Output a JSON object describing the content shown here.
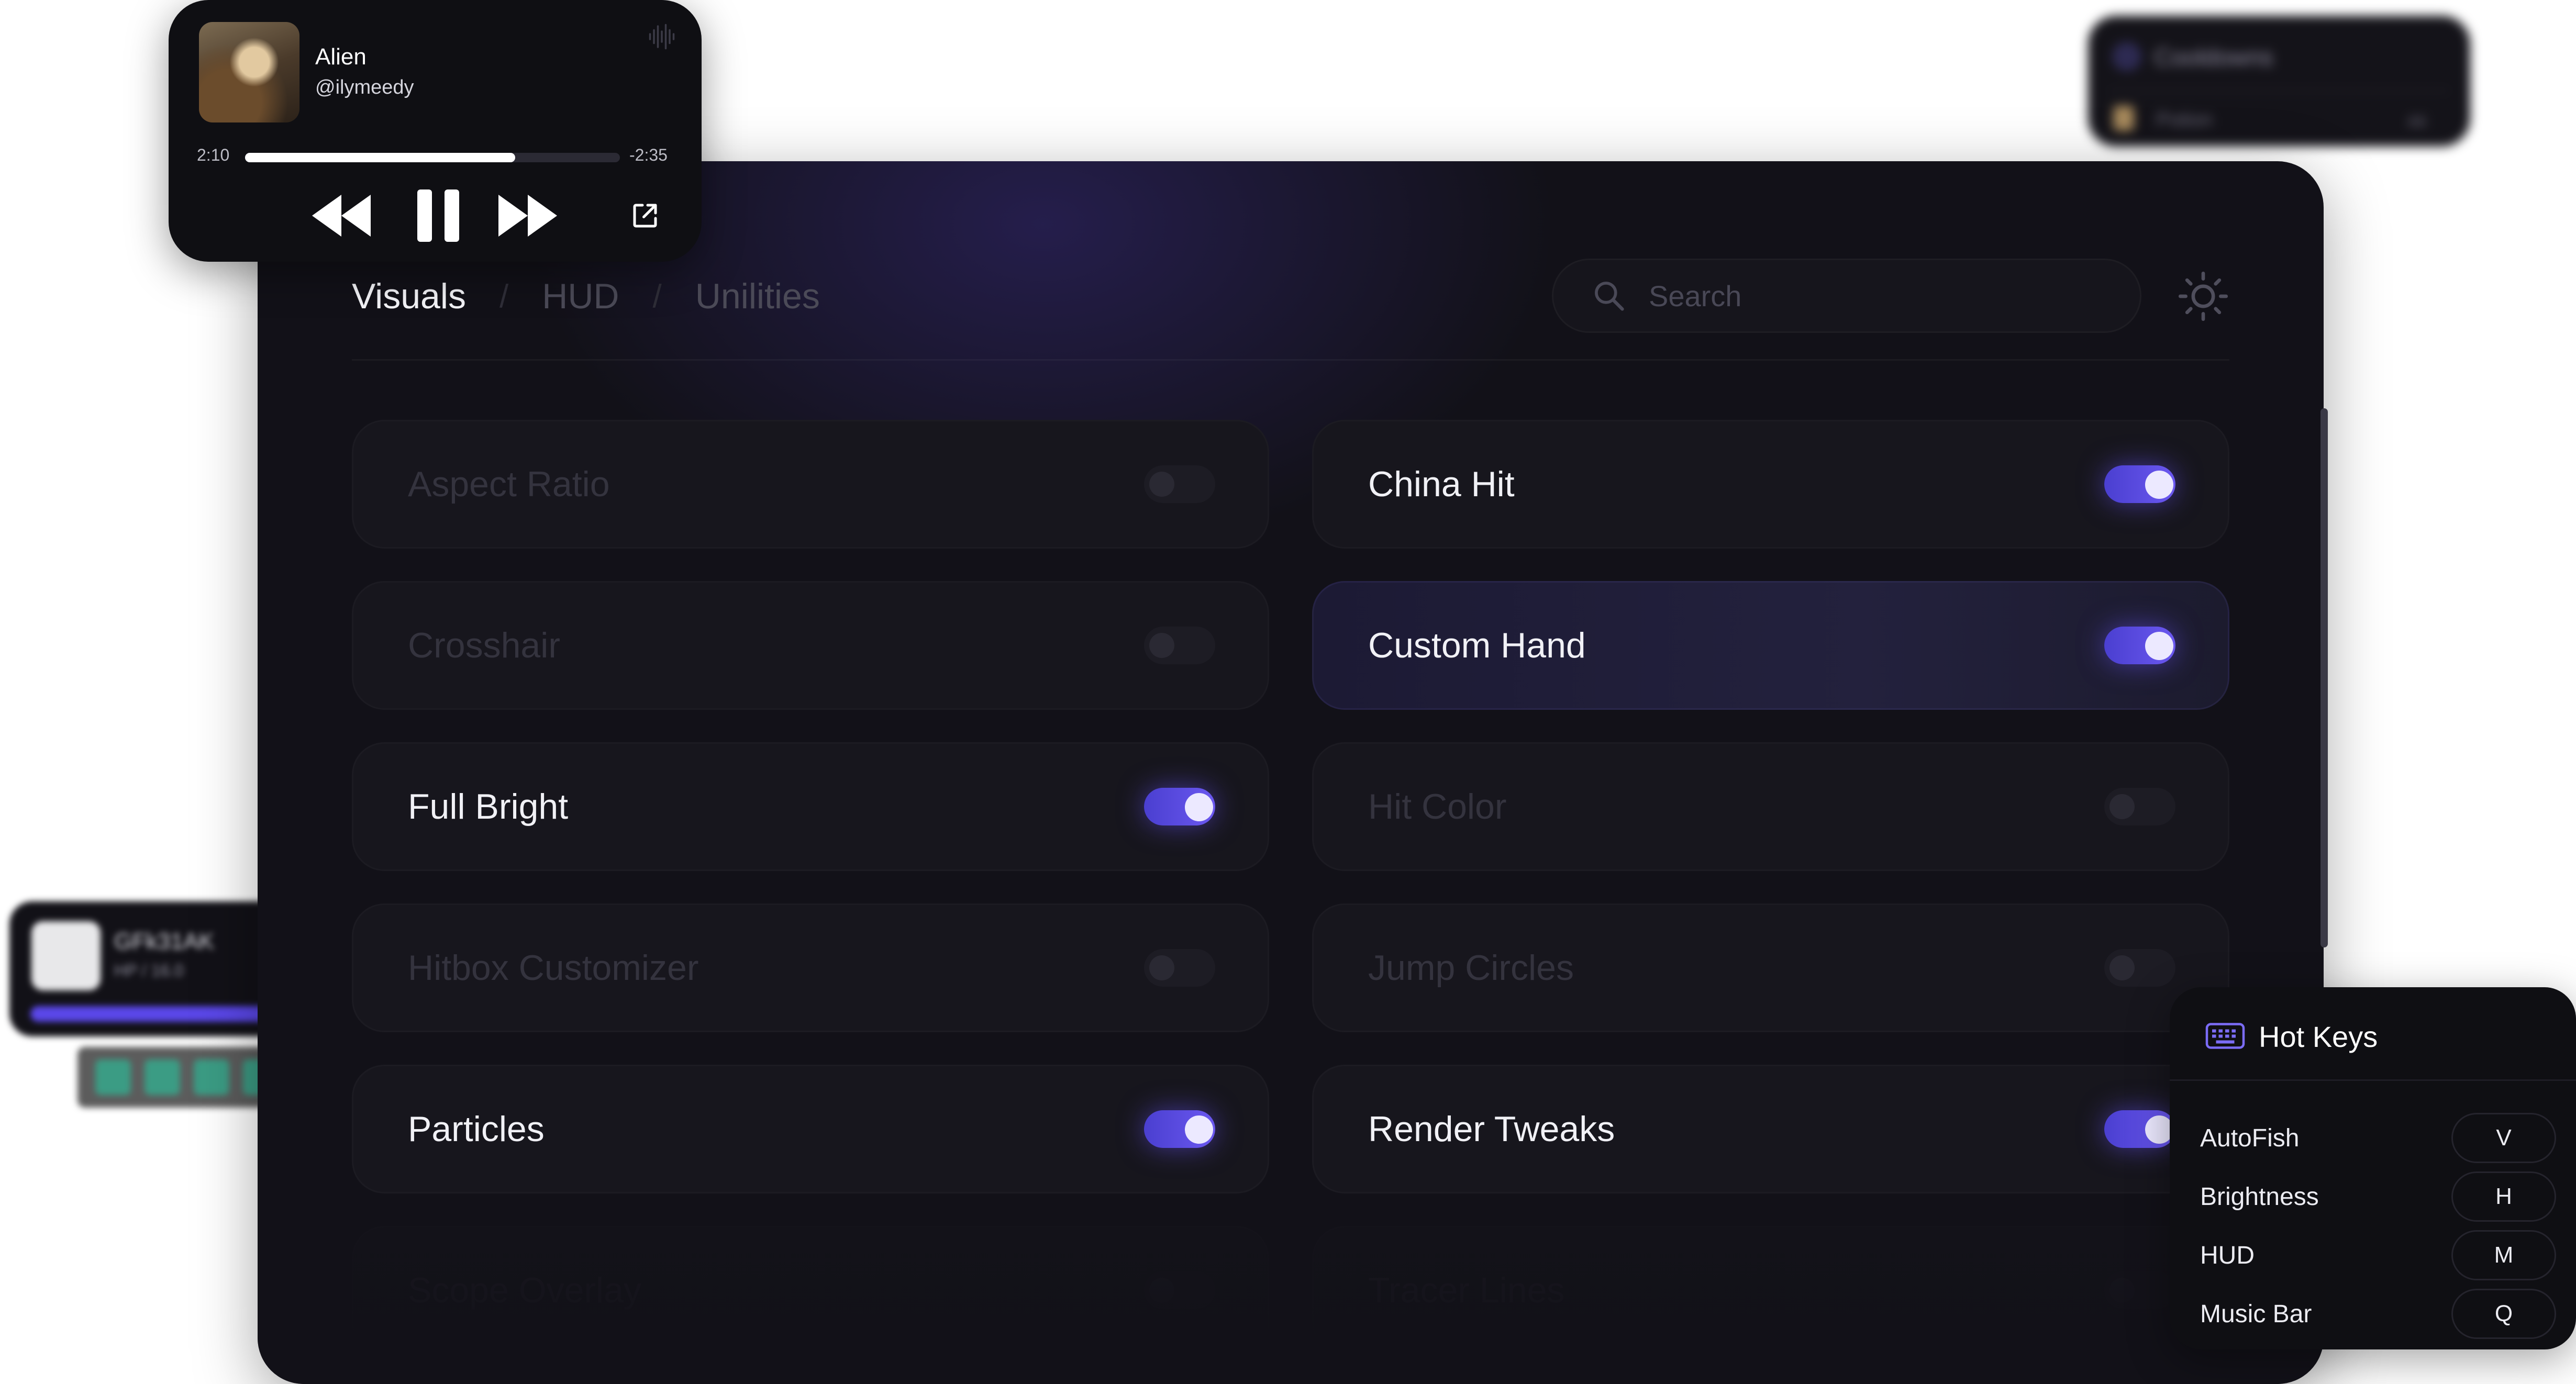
{
  "colors": {
    "accent": "#6b58f0",
    "panel_bg": "#121118",
    "card_bg": "#17161d",
    "text_on": "#f1f1f6",
    "text_off": "#34333e"
  },
  "tabs": [
    {
      "label": "Visuals",
      "active": true
    },
    {
      "label": "HUD",
      "active": false
    },
    {
      "label": "Unilities",
      "active": false
    }
  ],
  "tab_separator": "/",
  "search": {
    "placeholder": "Search"
  },
  "modules": [
    {
      "label": "Aspect Ratio",
      "enabled": false
    },
    {
      "label": "China Hit",
      "enabled": true
    },
    {
      "label": "Crosshair",
      "enabled": false
    },
    {
      "label": "Custom Hand",
      "enabled": true,
      "highlighted": true
    },
    {
      "label": "Full Bright",
      "enabled": true
    },
    {
      "label": "Hit Color",
      "enabled": false
    },
    {
      "label": "Hitbox Customizer",
      "enabled": false
    },
    {
      "label": "Jump Circles",
      "enabled": false
    },
    {
      "label": "Particles",
      "enabled": true
    },
    {
      "label": "Render Tweaks",
      "enabled": true
    },
    {
      "label": "Scope Overlay",
      "enabled": false,
      "faded": true
    },
    {
      "label": "Tracer Lines",
      "enabled": false,
      "faded": true
    }
  ],
  "music_player": {
    "title": "Alien",
    "artist": "@ilymeedy",
    "elapsed": "2:10",
    "remaining": "-2:35",
    "progress": 0.72,
    "icons": [
      "waveform-icon",
      "rewind-icon",
      "pause-icon",
      "fast-forward-icon",
      "external-link-icon"
    ]
  },
  "hotkeys": {
    "title": "Hot Keys",
    "icon": "keyboard-icon",
    "items": [
      {
        "name": "AutoFish",
        "key": "V"
      },
      {
        "name": "Brightness",
        "key": "H"
      },
      {
        "name": "HUD",
        "key": "M"
      },
      {
        "name": "Music Bar",
        "key": "Q"
      }
    ]
  },
  "cooldowns": {
    "title": "Cooldowns",
    "item": "Potion",
    "value": "44"
  },
  "target_hud": {
    "name": "GFk31AK",
    "hp": "HP / 16.0"
  }
}
